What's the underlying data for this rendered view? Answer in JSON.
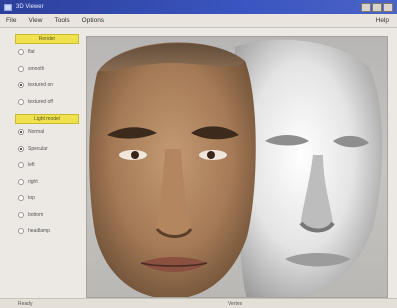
{
  "window": {
    "title": "3D Viewer"
  },
  "menu": {
    "items": [
      "File",
      "View",
      "Tools",
      "Options"
    ],
    "help": "Help"
  },
  "sidebar": {
    "sections": [
      {
        "label": "Render",
        "options": [
          {
            "label": "flat",
            "checked": false
          },
          {
            "label": "smooth",
            "checked": false
          },
          {
            "label": "textured on",
            "checked": true
          },
          {
            "label": "textured off",
            "checked": false
          }
        ]
      },
      {
        "label": "Light model",
        "options": [
          {
            "label": "Normal",
            "checked": true
          },
          {
            "label": "Specular",
            "checked": true
          },
          {
            "label": "left",
            "checked": false
          },
          {
            "label": "right",
            "checked": false
          },
          {
            "label": "top",
            "checked": false
          },
          {
            "label": "bottom",
            "checked": false
          },
          {
            "label": "headlamp",
            "checked": false
          }
        ]
      }
    ]
  },
  "viewport": {
    "textured_face_skin": "#a97f5c",
    "untextured_face_skin": "#e6e6e6",
    "background": "#bdbcb9"
  },
  "status": {
    "left": "Ready",
    "right": "Vertex"
  }
}
